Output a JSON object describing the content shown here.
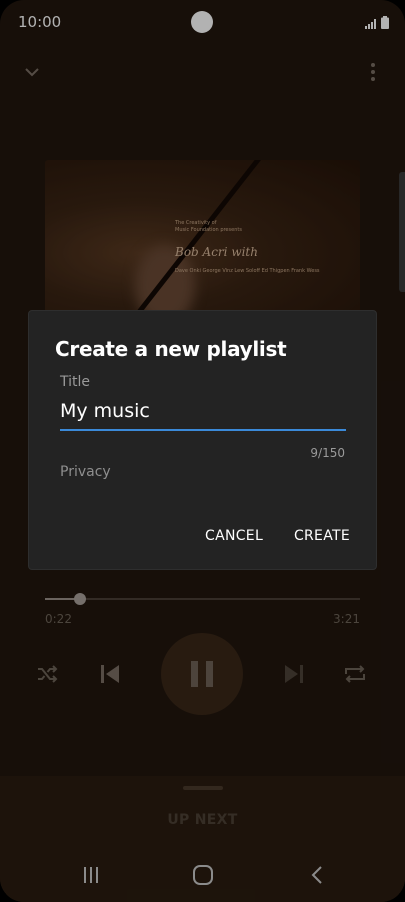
{
  "status_bar": {
    "time": "10:00"
  },
  "album_art": {
    "small_text": "The Creativity of\nMusic Foundation presents",
    "artist_name": "Bob Acri with",
    "credits": "Dave Onki George Vinz Lew Soloff  Ed Thigpen Frank Wess"
  },
  "player": {
    "elapsed": "0:22",
    "total": "3:21",
    "progress": 0.11
  },
  "up_next": {
    "label": "UP NEXT"
  },
  "dialog": {
    "title": "Create a new playlist",
    "field_label": "Title",
    "input_value": "My music",
    "char_count": "9/150",
    "privacy_label": "Privacy",
    "cancel_label": "CANCEL",
    "create_label": "CREATE",
    "accent_color": "#3b8ad9"
  },
  "icons": [
    "chevron-down-icon",
    "more-vert-icon",
    "shuffle-icon",
    "previous-icon",
    "pause-icon",
    "next-icon",
    "repeat-icon",
    "recents-icon",
    "home-icon",
    "back-icon"
  ]
}
